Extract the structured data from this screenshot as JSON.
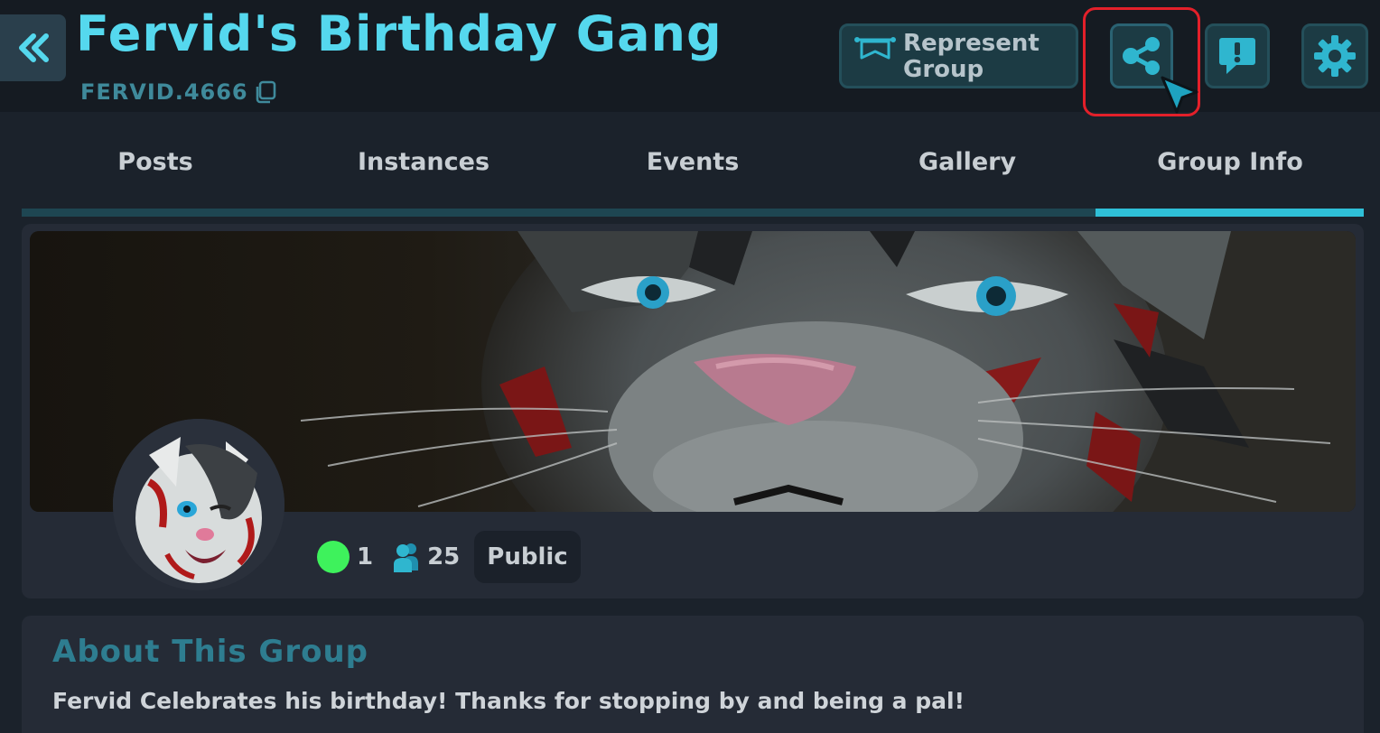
{
  "header": {
    "title": "Fervid's Birthday Gang",
    "group_code": "FERVID.4666",
    "represent_label_line1": "Represent",
    "represent_label_line2": "Group"
  },
  "icons": {
    "back": "double-chevron-left-icon",
    "copy": "copy-icon",
    "banner": "banner-icon",
    "share": "share-icon",
    "report": "report-icon",
    "settings": "gear-icon",
    "online": "online-dot",
    "members": "members-icon"
  },
  "tabs": [
    {
      "label": "Posts"
    },
    {
      "label": "Instances"
    },
    {
      "label": "Events"
    },
    {
      "label": "Gallery"
    },
    {
      "label": "Group Info",
      "active": true
    }
  ],
  "stats": {
    "online_count": "1",
    "member_count": "25",
    "privacy": "Public"
  },
  "about": {
    "title": "About This Group",
    "text": "Fervid Celebrates his birthday! Thanks for stopping by and being a pal!"
  },
  "colors": {
    "accent": "#55d8ee",
    "active_tab": "#2fc0d8",
    "online": "#3ef25c",
    "highlight": "#e3202a",
    "background": "#1b222b"
  }
}
